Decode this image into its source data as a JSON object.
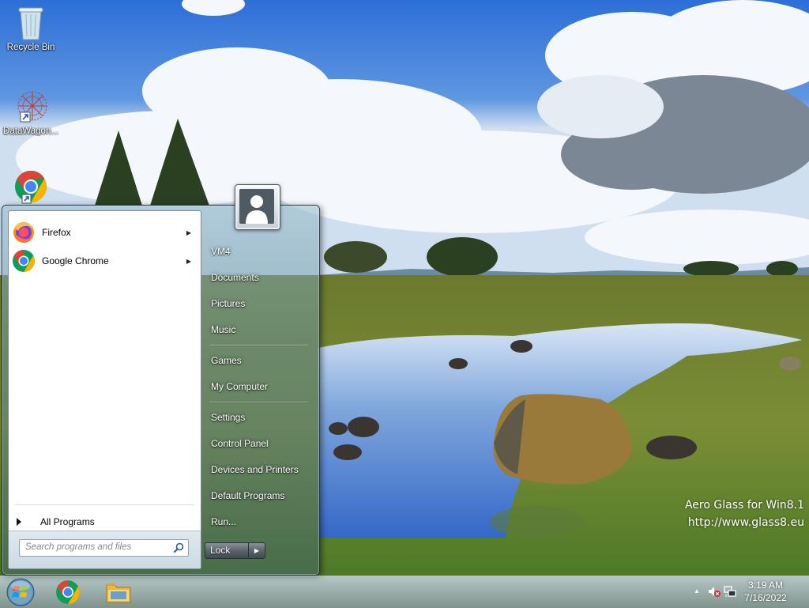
{
  "desktop": {
    "icons": [
      {
        "label": "Recycle Bin",
        "icon": "recycle-bin-icon"
      },
      {
        "label": "DataWagon...",
        "icon": "datawagon-shortcut-icon"
      },
      {
        "label": "",
        "icon": "chrome-shortcut-icon"
      }
    ],
    "watermark": {
      "line1": "Aero Glass for Win8.1",
      "line2": "http://www.glass8.eu"
    }
  },
  "start_menu": {
    "pinned_programs": [
      {
        "label": "Firefox",
        "icon": "firefox-icon",
        "has_submenu": true
      },
      {
        "label": "Google Chrome",
        "icon": "chrome-icon",
        "has_submenu": true
      }
    ],
    "all_programs_label": "All Programs",
    "search": {
      "placeholder": "Search programs and files",
      "value": ""
    },
    "right_pane": {
      "user_name": "VM4",
      "items": [
        "Documents",
        "Pictures",
        "Music",
        "Games",
        "My Computer",
        "Settings",
        "Control Panel",
        "Devices and Printers",
        "Default Programs",
        "Run..."
      ]
    },
    "lock_label": "Lock"
  },
  "taskbar": {
    "pinned": [
      {
        "name": "chrome",
        "icon": "chrome-icon"
      },
      {
        "name": "file-explorer",
        "icon": "folder-icon"
      }
    ],
    "clock": {
      "time": "3:19 AM",
      "date": "7/16/2022"
    },
    "tray_icons": [
      "show-hidden-icons-arrow",
      "volume-muted-icon",
      "network-icon"
    ]
  },
  "colors": {
    "accent_glass": "#6e8f95",
    "chrome_red": "#db4437",
    "chrome_green": "#0f9d58",
    "chrome_yellow": "#f4b400",
    "chrome_blue": "#4285f4"
  }
}
